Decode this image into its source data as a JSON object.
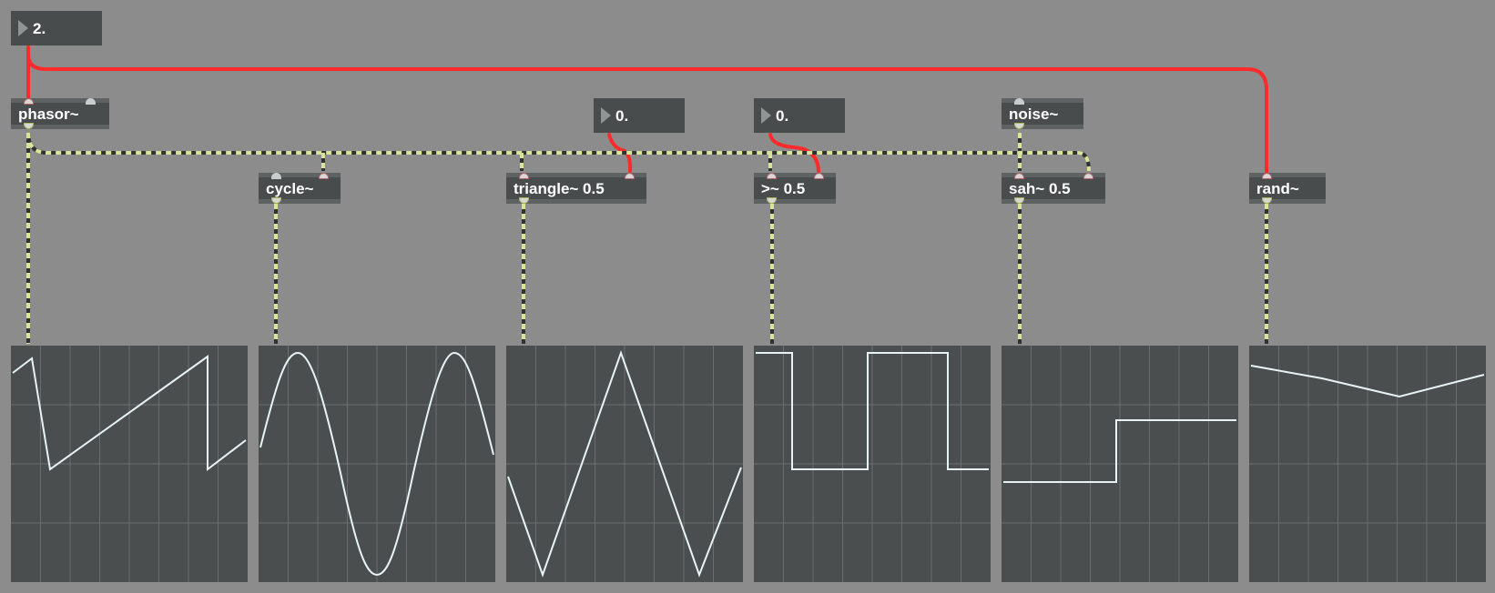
{
  "number_boxes": [
    {
      "id": "freq",
      "value": "2."
    },
    {
      "id": "triangle-phase",
      "value": "0."
    },
    {
      "id": "threshold",
      "value": "0."
    }
  ],
  "objects": [
    {
      "id": "phasor",
      "label": "phasor~"
    },
    {
      "id": "cycle",
      "label": "cycle~"
    },
    {
      "id": "triangle",
      "label": "triangle~ 0.5"
    },
    {
      "id": "compare",
      "label": ">~ 0.5"
    },
    {
      "id": "noise",
      "label": "noise~"
    },
    {
      "id": "sah",
      "label": "sah~ 0.5"
    },
    {
      "id": "rand",
      "label": "rand~"
    }
  ],
  "scopes": [
    {
      "id": "phasor-scope",
      "source": "phasor~"
    },
    {
      "id": "cycle-scope",
      "source": "cycle~"
    },
    {
      "id": "triangle-scope",
      "source": "triangle~ 0.5"
    },
    {
      "id": "compare-scope",
      "source": ">~ 0.5"
    },
    {
      "id": "sah-scope",
      "source": "sah~ 0.5"
    },
    {
      "id": "rand-scope",
      "source": "rand~"
    }
  ],
  "colors": {
    "background": "#8c8c8c",
    "object_fill": "#484c4c",
    "scope_fill": "#4a4e4e",
    "scope_grid": "#6a6e6e",
    "trace": "#e8f4f4",
    "message_cord": "#ff2222",
    "signal_cord": "#d9e39a"
  }
}
